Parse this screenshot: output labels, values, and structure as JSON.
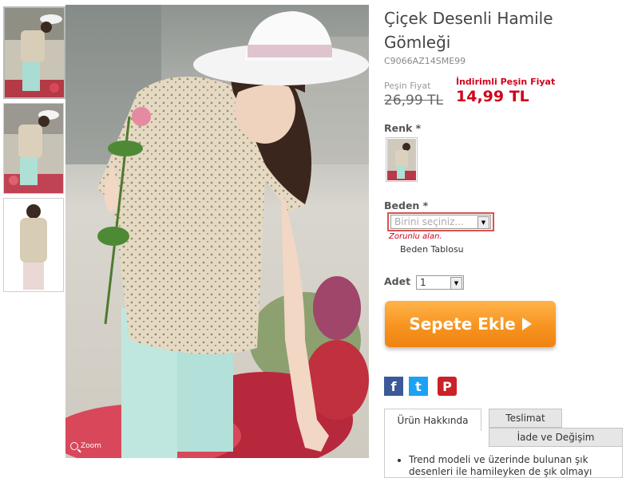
{
  "product": {
    "title": "Çiçek Desenli Hamile Gömleği",
    "sku": "C9066AZ14SME99"
  },
  "gallery": {
    "zoom_label": "Zoom",
    "thumbnails": [
      "front-with-hat",
      "front-flowers",
      "back-view"
    ]
  },
  "price": {
    "old_label": "Peşin Fiyat",
    "old_value": "26,99 TL",
    "new_label": "İndirimli Peşin Fiyat",
    "new_value": "14,99 TL"
  },
  "color": {
    "label": "Renk *"
  },
  "size": {
    "label": "Beden *",
    "placeholder": "Birini seçiniz...",
    "error": "Zorunlu alan.",
    "size_chart_link": "Beden Tablosu"
  },
  "quantity": {
    "label": "Adet",
    "value": "1"
  },
  "cart": {
    "add_label": "Sepete Ekle"
  },
  "social": {
    "facebook": {
      "glyph": "f",
      "color": "#3b5998"
    },
    "twitter": {
      "glyph": "t",
      "color": "#1da1f2"
    },
    "pinterest": {
      "glyph": "P",
      "color": "#cb2027"
    }
  },
  "tabs": {
    "items": [
      "Ürün Hakkında",
      "Teslimat",
      "İade ve Değişim"
    ],
    "content_lines": [
      "Trend modeli ve üzerinde bulunan şık",
      "desenleri ile hamileyken de şık olmayı"
    ]
  },
  "colors": {
    "accent_red": "#d0021b",
    "cart_orange": "#f79420"
  }
}
